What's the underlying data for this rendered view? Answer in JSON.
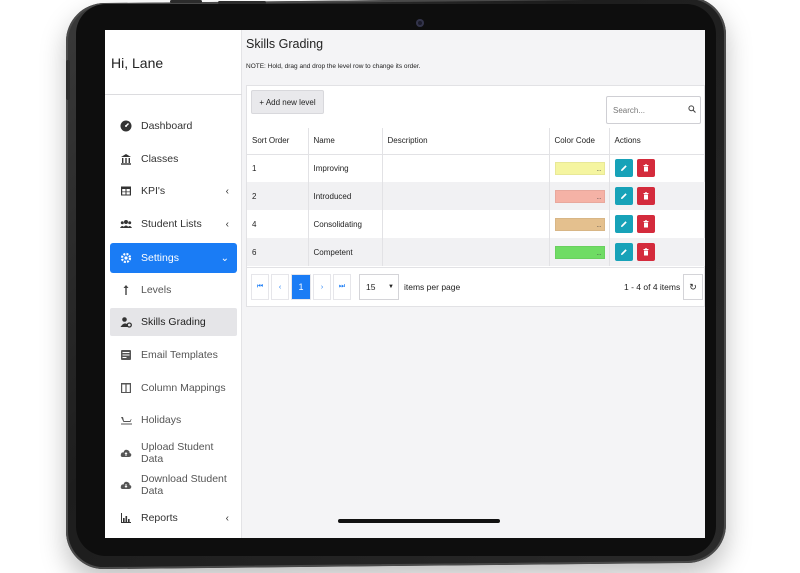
{
  "sidebar": {
    "greeting": "Hi, Lane",
    "items": [
      {
        "label": "Dashboard",
        "icon": "dashboard-gauge-icon"
      },
      {
        "label": "Classes",
        "icon": "building-columns-icon"
      },
      {
        "label": "KPI's",
        "icon": "table-icon",
        "chevron": "‹"
      },
      {
        "label": "Student Lists",
        "icon": "users-icon",
        "chevron": "‹"
      },
      {
        "label": "Settings",
        "icon": "gear-icon",
        "chevron": "⌄",
        "active": true
      },
      {
        "label": "Levels",
        "icon": "level-up-icon"
      },
      {
        "label": "Skills Grading",
        "icon": "user-cog-icon",
        "selected": true
      },
      {
        "label": "Email Templates",
        "icon": "email-template-icon"
      },
      {
        "label": "Column Mappings",
        "icon": "columns-icon"
      },
      {
        "label": "Holidays",
        "icon": "sleigh-icon"
      },
      {
        "label": "Upload Student Data",
        "icon": "cloud-upload-icon"
      },
      {
        "label": "Download Student Data",
        "icon": "cloud-download-icon"
      },
      {
        "label": "Reports",
        "icon": "chart-icon",
        "chevron": "‹"
      }
    ]
  },
  "main": {
    "title": "Skills Grading",
    "note": "NOTE: Hold, drag and drop the level row to change its order.",
    "add_button": "+ Add new level",
    "search_placeholder": "Search...",
    "columns": [
      "Sort Order",
      "Name",
      "Description",
      "Color Code",
      "Actions"
    ],
    "rows": [
      {
        "sort_order": "1",
        "name": "Improving",
        "description": "",
        "color": "#f5f5a0"
      },
      {
        "sort_order": "2",
        "name": "Introduced",
        "description": "",
        "color": "#f5b2a6"
      },
      {
        "sort_order": "4",
        "name": "Consolidating",
        "description": "",
        "color": "#e4c08e"
      },
      {
        "sort_order": "6",
        "name": "Competent",
        "description": "",
        "color": "#6fdc64"
      }
    ],
    "swatch_dots": "...",
    "pager": {
      "first": "⏮",
      "prev": "‹",
      "current_page": "1",
      "next": "›",
      "last": "⏭",
      "per_page": "15",
      "per_page_label": "items per page",
      "range": "1 - 4 of 4 items",
      "refresh": "↻"
    }
  },
  "colors": {
    "accent": "#1a7cf5",
    "edit": "#17a2b8",
    "delete": "#d42b3c"
  }
}
